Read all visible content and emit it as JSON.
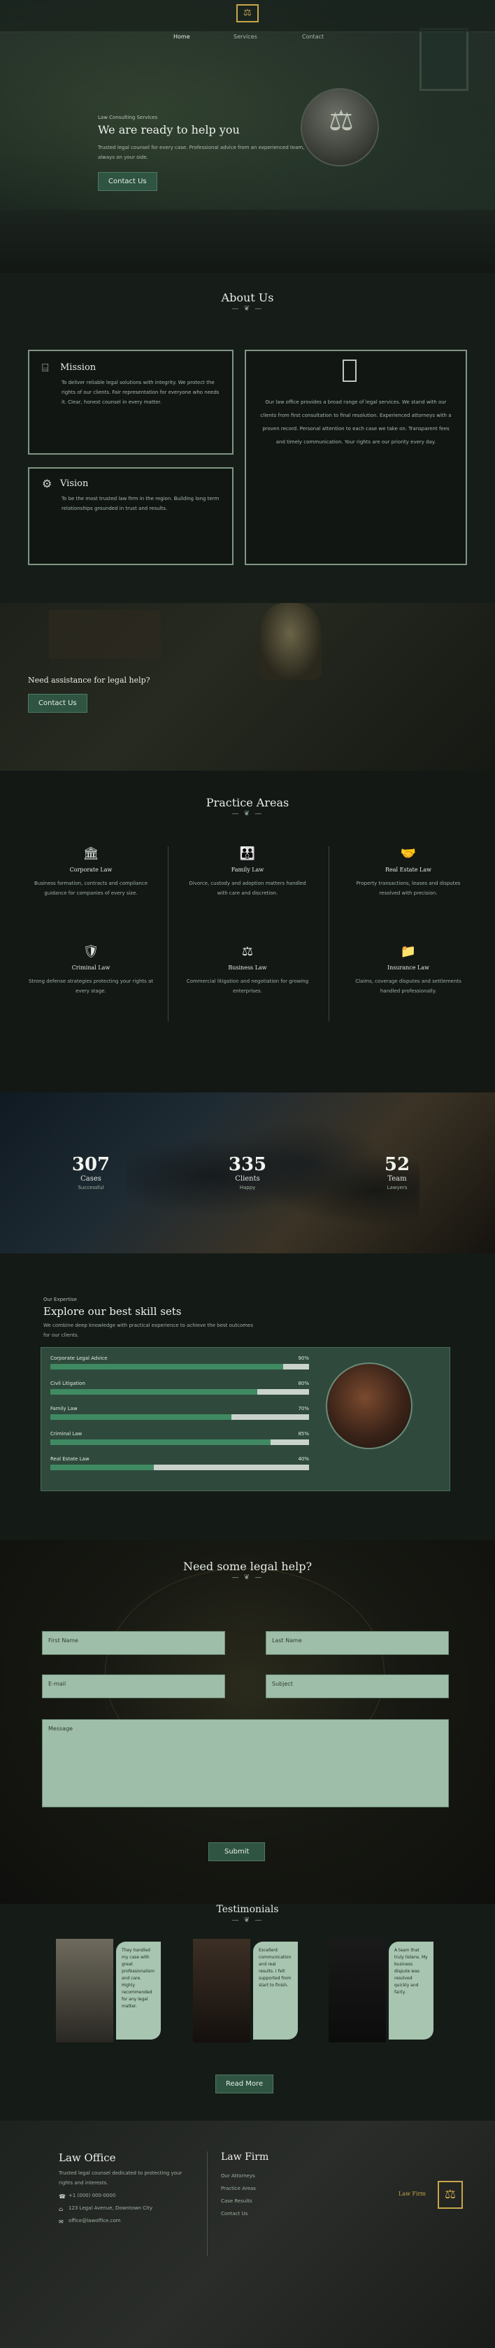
{
  "nav": {
    "items": [
      "Home",
      "Services",
      "Contact"
    ]
  },
  "logo": {
    "alt": "Law Office"
  },
  "hero": {
    "kicker": "Law Consulting Services",
    "title": "We are ready to help you",
    "subtitle": "Trusted legal counsel for every case. Professional advice from an experienced team, always on your side.",
    "button": "Contact Us"
  },
  "about": {
    "title": "About Us",
    "mission": {
      "title": "Mission",
      "text": "To deliver reliable legal solutions with integrity. We protect the rights of our clients. Fair representation for everyone who needs it. Clear, honest counsel in every matter."
    },
    "vision": {
      "title": "Vision",
      "text": "To be the most trusted law firm in the region. Building long term relationships grounded in trust and results."
    },
    "center_text": "Our law office provides a broad range of legal services. We stand with our clients from first consultation to final resolution. Experienced attorneys with a proven record. Personal attention to each case we take on. Transparent fees and timely communication. Your rights are our priority every day."
  },
  "assistance": {
    "title": "Need assistance for legal help?",
    "button": "Contact Us"
  },
  "practice": {
    "title": "Practice Areas",
    "items": [
      {
        "icon": "building-icon",
        "title": "Corporate Law",
        "text": "Business formation, contracts and compliance guidance for companies of every size."
      },
      {
        "icon": "family-icon",
        "title": "Family Law",
        "text": "Divorce, custody and adoption matters handled with care and discretion."
      },
      {
        "icon": "handshake-icon",
        "title": "Real Estate Law",
        "text": "Property transactions, leases and disputes resolved with precision."
      },
      {
        "icon": "shield-icon",
        "title": "Criminal Law",
        "text": "Strong defense strategies protecting your rights at every stage."
      },
      {
        "icon": "scale-icon",
        "title": "Business Law",
        "text": "Commercial litigation and negotiation for growing enterprises."
      },
      {
        "icon": "folder-icon",
        "title": "Insurance Law",
        "text": "Claims, coverage disputes and settlements handled professionally."
      }
    ]
  },
  "stats": [
    {
      "value": "307",
      "label": "Cases",
      "sub": "Successful"
    },
    {
      "value": "335",
      "label": "Clients",
      "sub": "Happy"
    },
    {
      "value": "52",
      "label": "Team",
      "sub": "Lawyers"
    }
  ],
  "skills": {
    "kicker": "Our Expertise",
    "title": "Explore our best skill sets",
    "intro": "We combine deep knowledge with practical experience to achieve the best outcomes for our clients.",
    "bars": [
      {
        "name": "Corporate Legal Advice",
        "percent": 90,
        "label": "90%"
      },
      {
        "name": "Civil Litigation",
        "percent": 80,
        "label": "80%"
      },
      {
        "name": "Family Law",
        "percent": 70,
        "label": "70%"
      },
      {
        "name": "Criminal Law",
        "percent": 85,
        "label": "85%"
      },
      {
        "name": "Real Estate Law",
        "percent": 40,
        "label": "40%"
      }
    ]
  },
  "form": {
    "title": "Need some legal help?",
    "first_name": "First Name",
    "last_name": "Last Name",
    "email": "E-mail",
    "subject": "Subject",
    "message": "Message",
    "submit": "Submit"
  },
  "testimonials": {
    "title": "Testimonials",
    "items": [
      {
        "text": "They handled my case with great professionalism and care. Highly recommended for any legal matter."
      },
      {
        "text": "Excellent communication and real results. I felt supported from start to finish."
      },
      {
        "text": "A team that truly listens. My business dispute was resolved quickly and fairly."
      }
    ],
    "button": "Read More"
  },
  "footer": {
    "brand": "Law Office",
    "about": "Trusted legal counsel dedicated to protecting your rights and interests.",
    "phone": "+1 (000) 000-0000",
    "address": "123 Legal Avenue, Downtown City",
    "email": "office@lawoffice.com",
    "links_title": "Law Firm",
    "links": [
      "Our Attorneys",
      "Practice Areas",
      "Case Results",
      "Contact Us"
    ],
    "badge": "Law Firm"
  },
  "colors": {
    "accent": "#2f5442",
    "bg": "#141816",
    "field": "#9fbea9",
    "gold": "#c9a64a"
  }
}
